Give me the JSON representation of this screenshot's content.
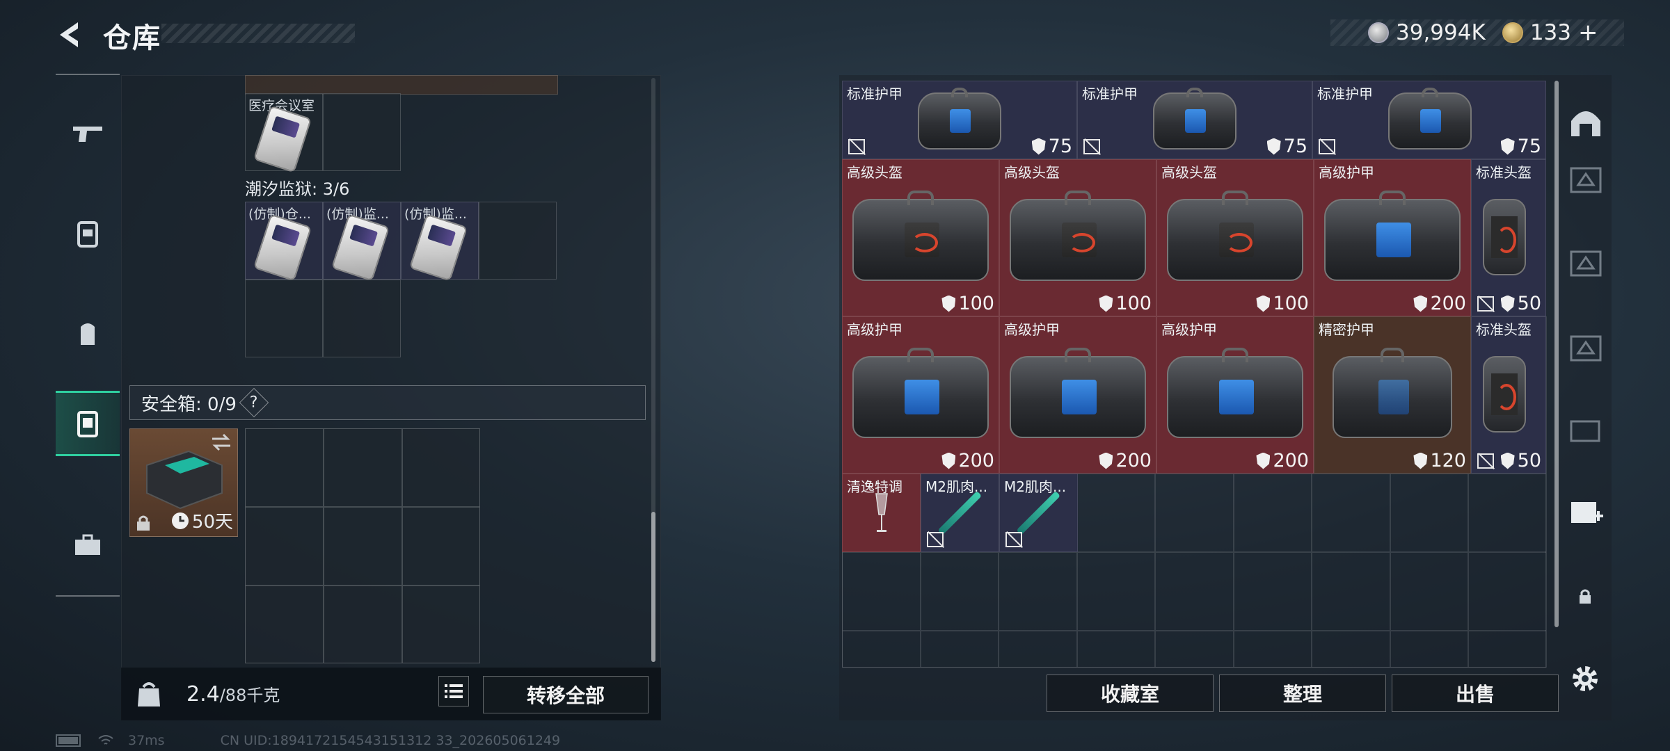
{
  "header": {
    "title": "仓库",
    "currency_silver": "39,994K",
    "currency_gold": "133",
    "add_symbol": "+"
  },
  "left_nav": {
    "items": [
      "weapon-icon",
      "armor-icon",
      "backpack-icon",
      "safe-case-icon",
      "briefcase-icon"
    ],
    "active_index": 3
  },
  "left_panel": {
    "top_item_label": "医疗会议室",
    "prison_title": "潮汐监狱: 3/6",
    "prison_items": [
      "(仿制)仓...",
      "(仿制)监...",
      "(仿制)监..."
    ],
    "safe_title": "安全箱: 0/9",
    "help": "?",
    "safe_box_days": "50天",
    "weight": "2.4",
    "weight_max": "/88千克",
    "transfer_all": "转移全部"
  },
  "grid_items": [
    {
      "label": "标准护甲",
      "durability": "75",
      "type": "bag-blue"
    },
    {
      "label": "标准护甲",
      "durability": "75",
      "type": "bag-blue"
    },
    {
      "label": "标准护甲",
      "durability": "75",
      "type": "bag-blue"
    },
    {
      "label": "高级头盔",
      "durability": "100",
      "type": "bag-red"
    },
    {
      "label": "高级头盔",
      "durability": "100",
      "type": "bag-red"
    },
    {
      "label": "高级头盔",
      "durability": "100",
      "type": "bag-red"
    },
    {
      "label": "高级护甲",
      "durability": "200",
      "type": "bag-blue"
    },
    {
      "label": "标准头盔",
      "durability": "50",
      "type": "helmet"
    },
    {
      "label": "高级护甲",
      "durability": "200",
      "type": "bag-blue"
    },
    {
      "label": "高级护甲",
      "durability": "200",
      "type": "bag-blue"
    },
    {
      "label": "高级护甲",
      "durability": "200",
      "type": "bag-blue"
    },
    {
      "label": "精密护甲",
      "durability": "120",
      "type": "bag-blue"
    },
    {
      "label": "标准头盔",
      "durability": "50",
      "type": "helmet"
    },
    {
      "label": "清逸特调",
      "durability": "",
      "type": "glass"
    },
    {
      "label": "M2肌肉...",
      "durability": "",
      "type": "syringe"
    },
    {
      "label": "M2肌肉...",
      "durability": "",
      "type": "syringe"
    }
  ],
  "buttons": {
    "collection": "收藏室",
    "organize": "整理",
    "sell": "出售"
  },
  "footer": {
    "ping": "37ms",
    "uid": "CN UID:1894172154543151312 33_202605061249"
  },
  "colors": {
    "accent_green": "#2fd0a0",
    "rare_red": "#6a2a32",
    "epic_blue": "#2c2f48",
    "legend_brown": "#4a3328"
  }
}
